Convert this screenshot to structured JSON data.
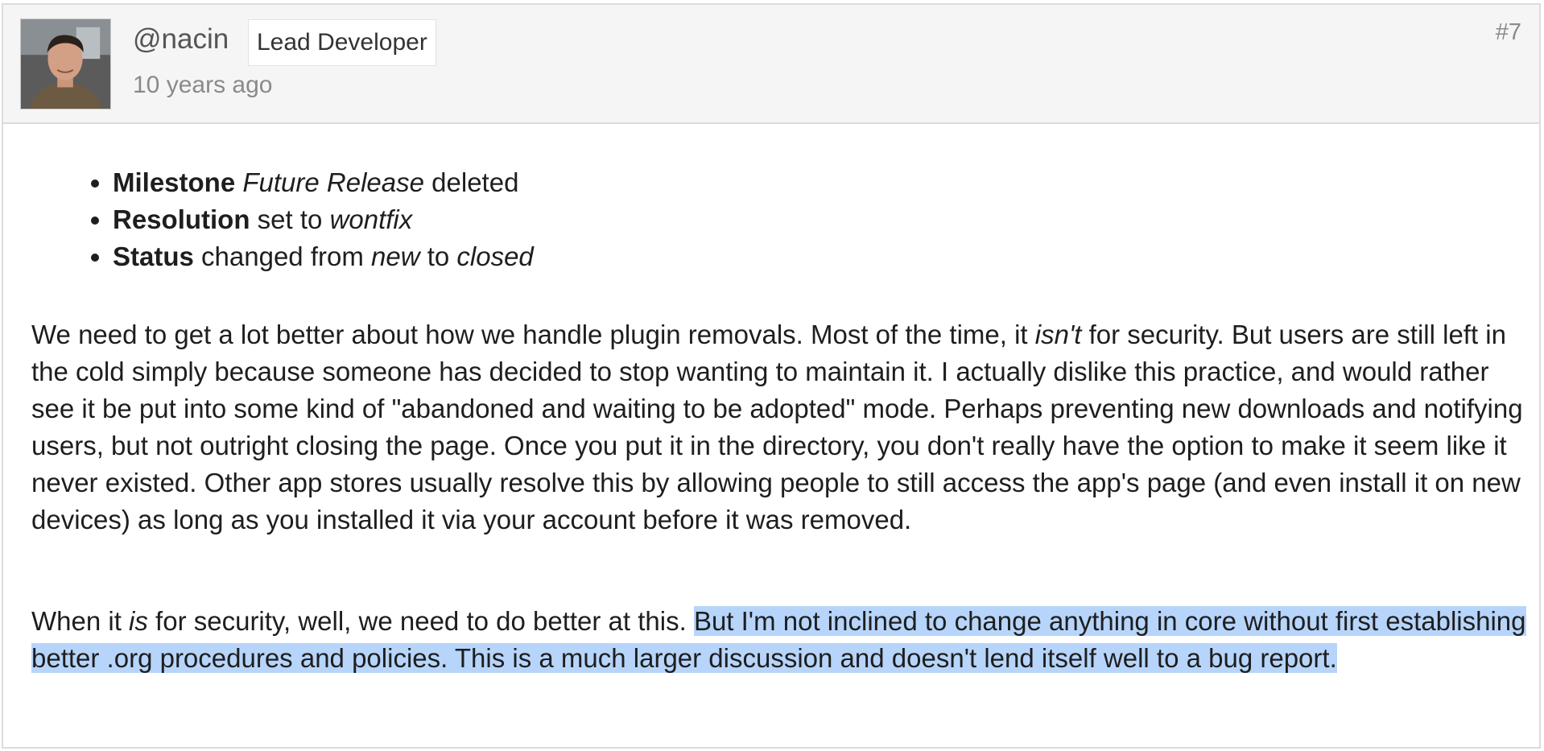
{
  "comment": {
    "author": "@nacin",
    "role": "Lead Developer",
    "time_ago": "10 years ago",
    "number": "#7",
    "avatar_icon": "user-avatar-photo",
    "changes": [
      {
        "field": "Milestone",
        "pre": " ",
        "val1": "Future Release",
        "mid": " deleted",
        "val2": ""
      },
      {
        "field": "Resolution",
        "pre": " set to ",
        "val1": "wontfix",
        "mid": "",
        "val2": ""
      },
      {
        "field": "Status",
        "pre": " changed from ",
        "val1": "new",
        "mid": " to ",
        "val2": "closed"
      }
    ],
    "paragraph1": {
      "a": "We need to get a lot better about how we handle plugin removals. Most of the time, it ",
      "em": "isn't",
      "b": " for security. But users are still left in the cold simply because someone has decided to stop wanting to maintain it. I actually dislike this practice, and would rather see it be put into some kind of \"abandoned and waiting to be adopted\" mode. Perhaps preventing new downloads and notifying users, but not outright closing the page. Once you put it in the directory, you don't really have the option to make it seem like it never existed. Other app stores usually resolve this by allowing people to still access the app's page (and even install it on new devices) as long as you installed it via your account before it was removed."
    },
    "paragraph2": {
      "a": "When it ",
      "em": "is",
      "b": " for security, well, we need to do better at this. ",
      "highlighted": "But I'm not inclined to change anything in core without first establishing better .org procedures and policies. This is a much larger discussion and doesn't lend itself well to a bug report."
    }
  },
  "colors": {
    "selection_highlight": "#b7d5fb",
    "header_bg": "#f5f5f5",
    "border": "#dcdcdc"
  }
}
